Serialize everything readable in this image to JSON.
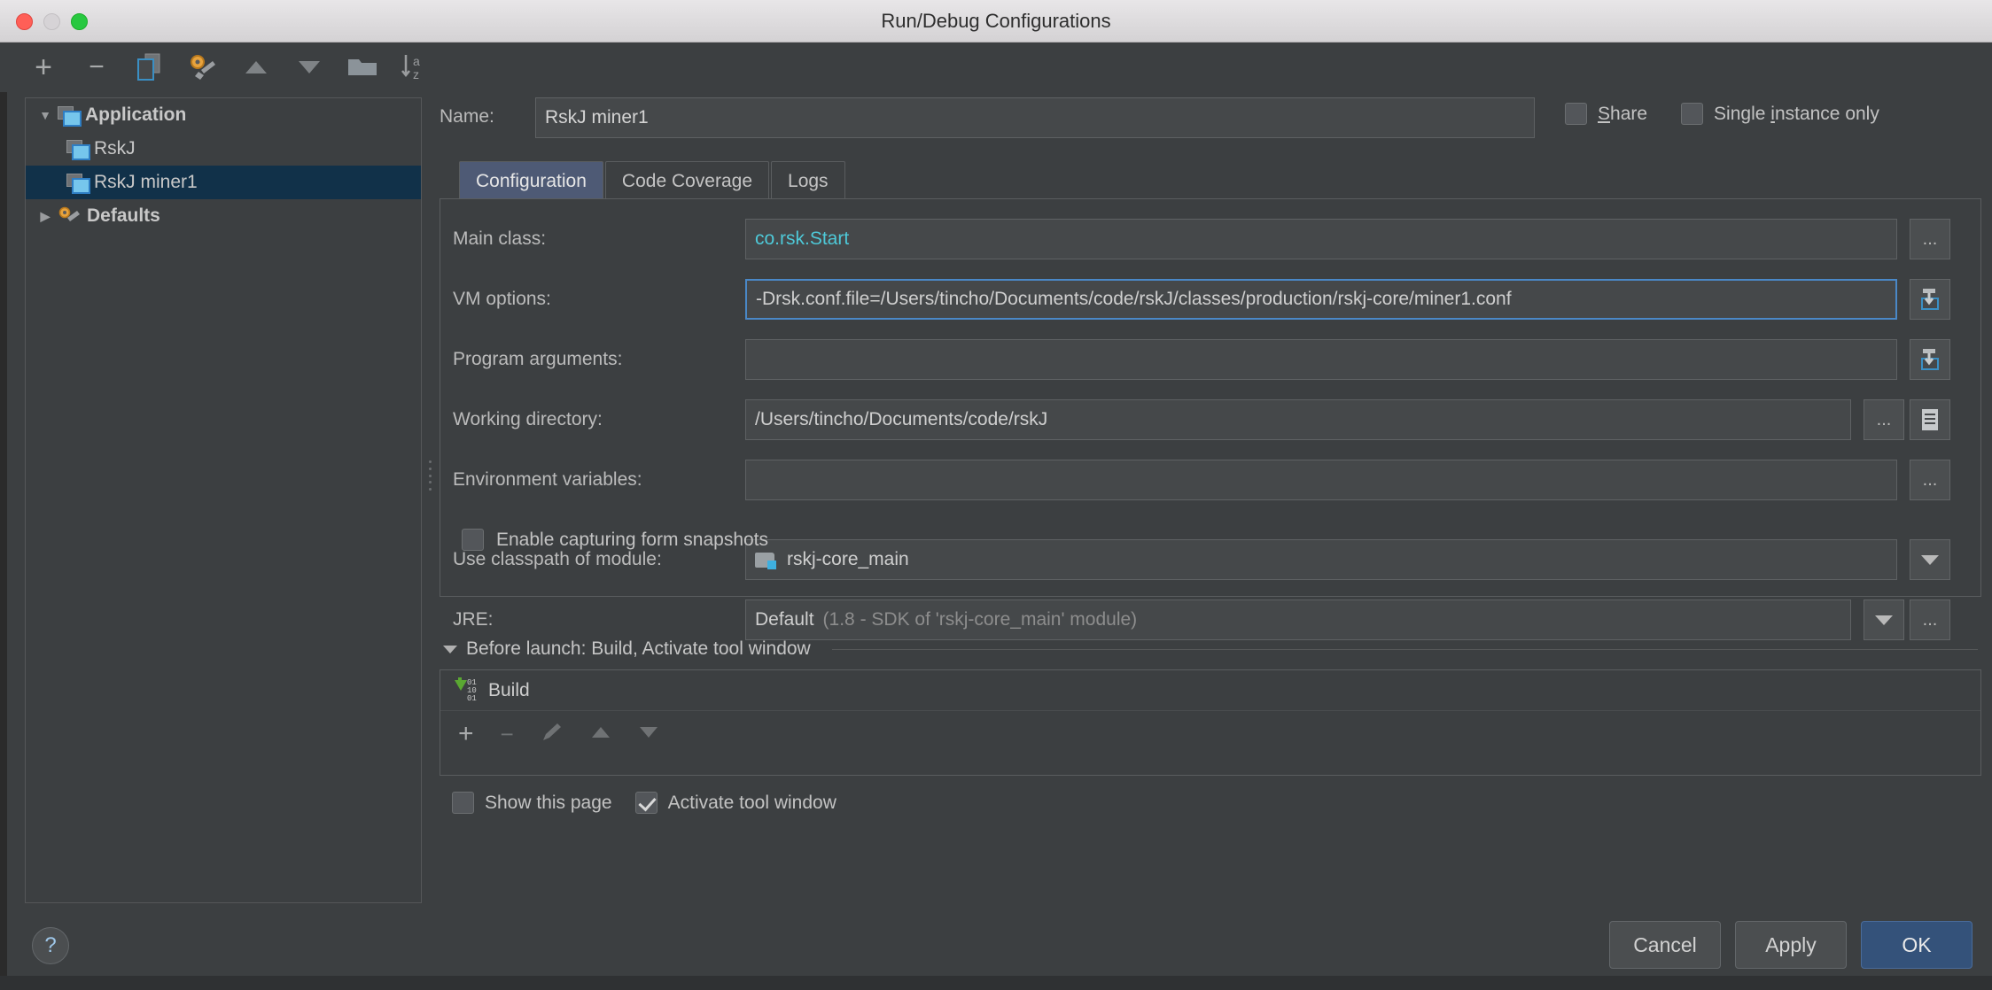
{
  "window": {
    "title": "Run/Debug Configurations"
  },
  "toolbar": {
    "items": [
      {
        "name": "add-icon",
        "glyph": "+"
      },
      {
        "name": "remove-icon",
        "glyph": "−"
      },
      {
        "name": "copy-configuration-icon",
        "glyph": "❐"
      },
      {
        "name": "edit-defaults-icon",
        "glyph": "⚙"
      },
      {
        "name": "move-up-icon",
        "glyph": "▲"
      },
      {
        "name": "move-down-icon",
        "glyph": "▼"
      },
      {
        "name": "folder-icon",
        "glyph": "▬"
      },
      {
        "name": "sort-alphabetically-icon",
        "glyph": "↓"
      }
    ]
  },
  "tree": {
    "nodes": [
      {
        "label": "Application",
        "twisty": "▼",
        "icon": "application-icon",
        "bold": true,
        "selected": false,
        "indent": 0
      },
      {
        "label": "RskJ",
        "twisty": "",
        "icon": "application-icon",
        "bold": false,
        "selected": false,
        "indent": 1
      },
      {
        "label": "RskJ miner1",
        "twisty": "",
        "icon": "application-icon",
        "bold": false,
        "selected": true,
        "indent": 1
      },
      {
        "label": "Defaults",
        "twisty": "▶",
        "icon": "wrench-icon",
        "bold": true,
        "selected": false,
        "indent": 0
      }
    ]
  },
  "form": {
    "name_label": "Name:",
    "name_value": "RskJ miner1",
    "share_label": "Share",
    "share_mnemonic": "S",
    "share_rest": "hare",
    "single_instance_label": "Single instance only",
    "single_instance_pre": "Single ",
    "single_instance_mnemonic": "i",
    "single_instance_post": "nstance only"
  },
  "tabs": [
    {
      "label": "Configuration",
      "active": true
    },
    {
      "label": "Code Coverage",
      "active": false
    },
    {
      "label": "Logs",
      "active": false
    }
  ],
  "fields": {
    "main_class_label": "Main class:",
    "main_class_value": "co.rsk.Start",
    "vm_options_label": "VM options:",
    "vm_options_value": "-Drsk.conf.file=/Users/tincho/Documents/code/rskJ/classes/production/rskj-core/miner1.conf",
    "program_arguments_label": "Program arguments:",
    "program_arguments_value": "",
    "working_directory_label": "Working directory:",
    "working_directory_value": "/Users/tincho/Documents/code/rskJ",
    "environment_variables_label": "Environment variables:",
    "environment_variables_value": "",
    "classpath_label": "Use classpath of module:",
    "classpath_value": "rskj-core_main",
    "jre_label": "JRE:",
    "jre_value": "Default",
    "jre_detail": "(1.8 - SDK of 'rskj-core_main' module)",
    "snapshots_label": "Enable capturing form snapshots",
    "snapshots_checked": false,
    "ellipsis": "...",
    "expand_glyph": "↓"
  },
  "before_launch": {
    "title": "Before launch: Build, Activate tool window",
    "items": [
      {
        "label": "Build",
        "icon": "build-icon"
      }
    ],
    "tools": [
      {
        "name": "add-task-icon",
        "glyph": "+"
      },
      {
        "name": "remove-task-icon",
        "glyph": "−"
      },
      {
        "name": "edit-task-icon",
        "glyph": "✎"
      },
      {
        "name": "move-task-up-icon",
        "glyph": "▲"
      },
      {
        "name": "move-task-down-icon",
        "glyph": "▼"
      }
    ],
    "show_page_label": "Show this page",
    "show_page_checked": false,
    "activate_tool_window_label": "Activate tool window",
    "activate_tool_window_checked": true
  },
  "footer": {
    "help_glyph": "?",
    "cancel_label": "Cancel",
    "apply_label": "Apply",
    "ok_label": "OK"
  },
  "colors": {
    "accent_blue": "#4e5a75",
    "selection_blue": "#113149",
    "primary_button": "#34527a",
    "main_class_text": "#4ec9d8",
    "focus_border": "#4a88c7"
  }
}
